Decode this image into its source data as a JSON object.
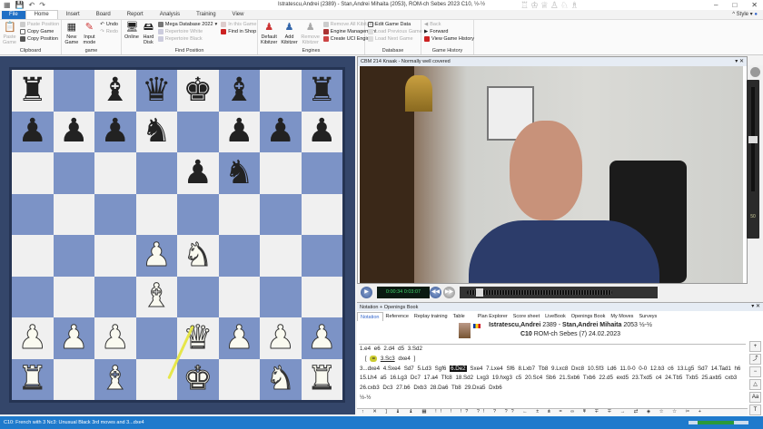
{
  "window": {
    "title": "Istratescu,Andrei (2389) - Stan,Andrei Mihaita (2053), ROM-ch Sebes 2023  C10, ½-½",
    "style_label": "Style"
  },
  "tabs": [
    "File",
    "Home",
    "Insert",
    "Board",
    "Report",
    "Analysis",
    "Training",
    "View"
  ],
  "ribbon": {
    "clipboard": {
      "label": "Clipboard",
      "paste_game": "Paste Game",
      "paste_position": "Paste Position",
      "copy_game": "Copy Game",
      "copy_position": "Copy Position"
    },
    "game": {
      "label": "game",
      "new_game": "New Game",
      "input_mode": "Input mode",
      "undo": "Undo",
      "redo": "Redo"
    },
    "find": {
      "label": "Find Position",
      "online": "Online",
      "hard_disk": "Hard Disk",
      "database": "Mega Database 2022",
      "rep_white": "Repertoire White",
      "rep_black": "Repertoire Black",
      "in_this_game": "In this Game",
      "find_in_shop": "Find in Shop"
    },
    "engines": {
      "label": "Engines",
      "default_kibitzer": "Default Kibitzer",
      "add_kibitzer": "Add Kibitzer",
      "remove_kibitzer": "Remove Kibitzer",
      "remove_all": "Remove All Kibitzers",
      "engine_management": "Engine Management",
      "create_uci": "Create UCI Engine"
    },
    "database": {
      "label": "Database",
      "edit_game_data": "Edit Game Data",
      "load_previous": "Load Previous Game",
      "load_next": "Load Next Game"
    },
    "history": {
      "label": "Game History",
      "back": "Back",
      "forward": "Forward",
      "view_history": "View Game History"
    }
  },
  "board": {
    "ranks": [
      "rxbqkbxr",
      "pppn.ppp",
      "....pn..",
      "........",
      "...PN...",
      "...B....",
      "PPP.QPPP",
      "R.B.K.NR"
    ],
    "arrow": {
      "from": "e2",
      "to": "d1",
      "color": "#e6e64a"
    },
    "light": "#f0f0f0",
    "dark": "#7c93c6"
  },
  "video": {
    "title": "CBM 214 Knaak - Normally well covered",
    "time_current": "0:00:34",
    "time_total": "0:03:07",
    "volume": "50"
  },
  "notation": {
    "title": "Notation + Openings Book",
    "tabs": [
      "Notation",
      "Reference",
      "Replay training",
      "Table",
      "Plan Explorer",
      "Score sheet",
      "LiveBook",
      "Openings Book",
      "My Moves",
      "Surveys"
    ],
    "white": "Istratescu,Andrei",
    "white_elo": "2389",
    "black": "Stan,Andrei Mihaita",
    "black_elo": "2053",
    "result": "½-½",
    "eco": "C10",
    "event": "ROM-ch Sebes (7) 24.02.2023",
    "line1": "1.e4  e6  2.d4  d5  3.Sd2",
    "variation_move": "3.Sc3",
    "variation_rest": "dxe4 ]",
    "main_before": "3...dxe4  4.Sxe4  Sd7  5.Ld3  Sgf6 ",
    "current_move": "6.De2",
    "main_after": " Sxe4  7.Lxe4  Sf6  8.Lxb7  Tb8  9.Lxc8  Dxc8  10.Sf3  Ld6  11.0-0  0-0  12.b3  c6  13.Lg5  Sd7  14.Tad1  h6  15.Lh4  a5  16.Lg3  Dc7  17.a4  Tfc8  18.Sd2  Lxg3  19.hxg3  c5  20.Sc4  Sb6  21.Sxb6  Txb6  22.d5  exd5  23.Txd5  c4  24.Tb5  Txb5  25.axb5  cxb3  26.cxb3  Dc3  27.b6  Dxb3  28.Da6  Tb8  29.Dxa5  Dxb6",
    "final_result": "½-½",
    "symbols": "↑ ✕ ] ♝ ♝ ▦ !! ! !? ?! ? ?? ← ± ⩲ = ∞ ⩱ ∓ ∓ → ⇄ ◈ ☆ ☆ ✂ +"
  },
  "status": {
    "text": "C10: French with 3 Nc3: Unusual Black 3rd moves and 3...dxe4",
    "progress": 0.75
  }
}
